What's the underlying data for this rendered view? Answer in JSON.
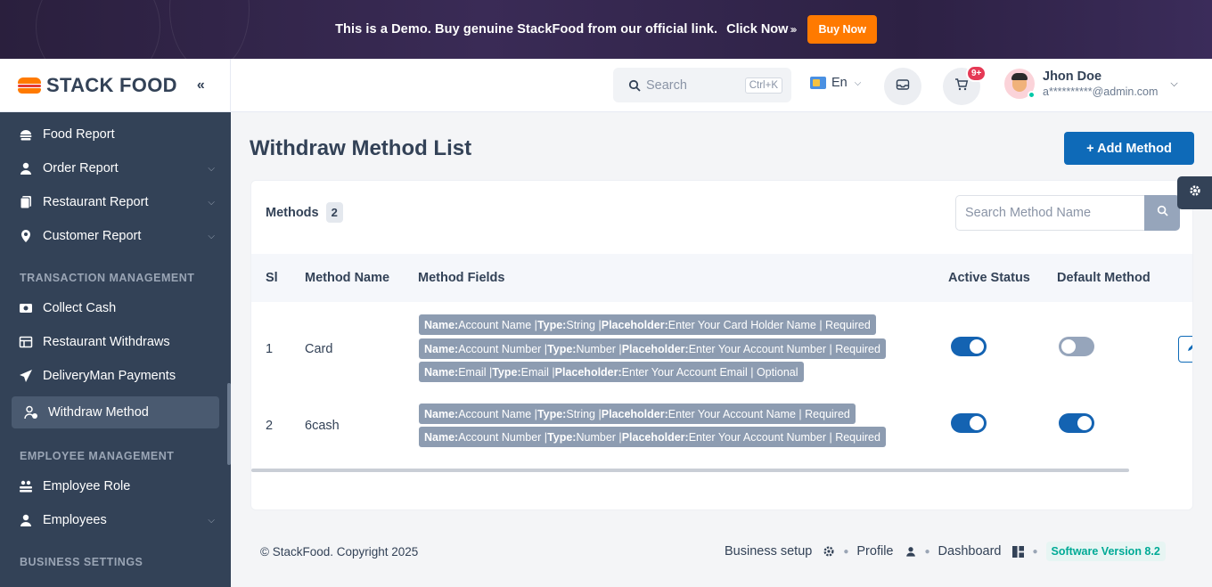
{
  "banner": {
    "text": "This is a Demo. Buy genuine StackFood from our official link.",
    "click_now": "Click Now",
    "arrows": "›››",
    "buy_now": "Buy Now"
  },
  "brand": {
    "name": "STACK FOOD",
    "collapse_icon": "«"
  },
  "sidebar": {
    "items_top": [
      {
        "label": "Food Report",
        "icon": "food-report-icon",
        "has_chevron": false
      },
      {
        "label": "Order Report",
        "icon": "user-icon",
        "has_chevron": true
      },
      {
        "label": "Restaurant Report",
        "icon": "document-icon",
        "has_chevron": true
      },
      {
        "label": "Customer Report",
        "icon": "location-pin-icon",
        "has_chevron": true
      }
    ],
    "transaction_title": "TRANSACTION MANAGEMENT",
    "transaction_items": [
      {
        "label": "Collect Cash"
      },
      {
        "label": "Restaurant Withdraws"
      },
      {
        "label": "DeliveryMan Payments"
      },
      {
        "label": "Withdraw Method",
        "active": true
      }
    ],
    "employee_title": "EMPLOYEE MANAGEMENT",
    "employee_items": [
      {
        "label": "Employee Role"
      },
      {
        "label": "Employees"
      }
    ],
    "business_title": "BUSINESS SETTINGS"
  },
  "topbar": {
    "search_placeholder": "Search",
    "search_shortcut": "Ctrl+K",
    "language": "En",
    "cart_badge": "9+",
    "user_name": "Jhon Doe",
    "user_email": "a**********@admin.com"
  },
  "page": {
    "title": "Withdraw Method List",
    "add_button": "+ Add Method"
  },
  "card": {
    "methods_label": "Methods",
    "methods_count": "2",
    "search_placeholder": "Search Method Name",
    "columns": [
      "Sl",
      "Method Name",
      "Method Fields",
      "Active Status",
      "Default Method"
    ],
    "rows": [
      {
        "sl": "1",
        "name": "Card",
        "fields": [
          "Name: Account Name | Type: String | Placeholder: Enter Your Card Holder Name | Required",
          "Name: Account Number | Type: Number | Placeholder: Enter Your Account Number | Required",
          "Name: Email | Type: Email | Placeholder: Enter Your Account Email | Optional"
        ],
        "active": true,
        "default": false
      },
      {
        "sl": "2",
        "name": "6cash",
        "fields": [
          "Name: Account Name | Type: String | Placeholder: Enter Your Account Name | Required",
          "Name: Account Number | Type: Number | Placeholder: Enter Your Account Number | Required"
        ],
        "active": true,
        "default": true
      }
    ]
  },
  "footer": {
    "copyright": "© StackFood. Copyright 2025",
    "links": [
      "Business setup",
      "Profile",
      "Dashboard"
    ],
    "version": "Software Version 8.2"
  },
  "colors": {
    "sidebar_bg": "#334257",
    "primary": "#0e6ab8",
    "buy_now": "#ff7a00",
    "chip": "#8d9cb1"
  }
}
